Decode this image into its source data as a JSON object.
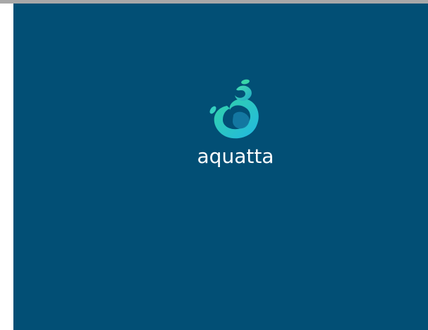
{
  "brand": {
    "name": "aquatta",
    "logo_icon": "water-splash-icon",
    "background_color": "#024f75",
    "accent_color": "#2ec6b6"
  }
}
